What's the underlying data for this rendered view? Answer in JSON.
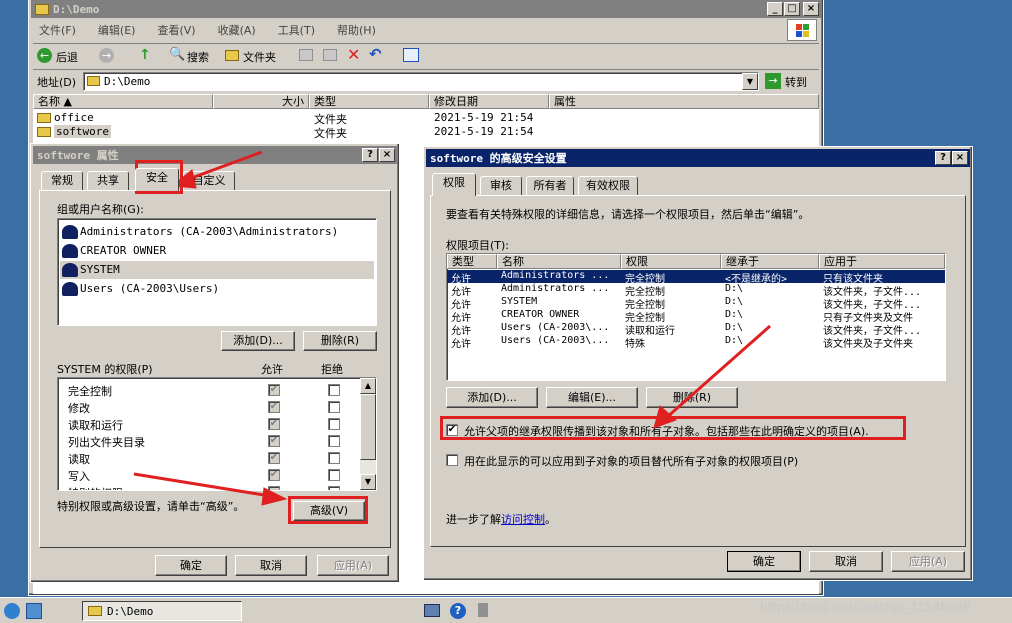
{
  "explorer": {
    "title": "D:\\Demo",
    "menu": [
      "文件(F)",
      "编辑(E)",
      "查看(V)",
      "收藏(A)",
      "工具(T)",
      "帮助(H)"
    ],
    "toolbar": {
      "back": "后退",
      "search": "搜索",
      "folders": "文件夹"
    },
    "address_label": "地址(D)",
    "address_value": "D:\\Demo",
    "go_label": "转到",
    "columns": [
      "名称",
      "大小",
      "类型",
      "修改日期",
      "属性"
    ],
    "files": [
      {
        "name": "office",
        "type": "文件夹",
        "date": "2021-5-19 21:54"
      },
      {
        "name": "softwore",
        "type": "文件夹",
        "date": "2021-5-19 21:54"
      }
    ]
  },
  "props": {
    "title": "softwore 属性",
    "tabs": [
      "常规",
      "共享",
      "安全",
      "自定义"
    ],
    "group_label": "组或用户名称(G):",
    "users": [
      "Administrators (CA-2003\\Administrators)",
      "CREATOR OWNER",
      "SYSTEM",
      "Users (CA-2003\\Users)"
    ],
    "add_button": "添加(D)...",
    "remove_button": "删除(R)",
    "perm_label": "SYSTEM 的权限(P)",
    "allow_label": "允许",
    "deny_label": "拒绝",
    "perms": [
      "完全控制",
      "修改",
      "读取和运行",
      "列出文件夹目录",
      "读取",
      "写入",
      "特别的权限"
    ],
    "advanced_note": "特别权限或高级设置，请单击“高级”。",
    "advanced_button": "高级(V)",
    "ok": "确定",
    "cancel": "取消",
    "apply": "应用(A)"
  },
  "adv": {
    "title": "softwore 的高级安全设置",
    "tabs": [
      "权限",
      "审核",
      "所有者",
      "有效权限"
    ],
    "intro": "要查看有关特殊权限的详细信息，请选择一个权限项目，然后单击“编辑”。",
    "entries_label": "权限项目(T):",
    "columns": [
      "类型",
      "名称",
      "权限",
      "继承于",
      "应用于"
    ],
    "rows": [
      [
        "允许",
        "Administrators ...",
        "完全控制",
        "<不是继承的>",
        "只有该文件夹"
      ],
      [
        "允许",
        "Administrators ...",
        "完全控制",
        "D:\\",
        "该文件夹，子文件..."
      ],
      [
        "允许",
        "SYSTEM",
        "完全控制",
        "D:\\",
        "该文件夹，子文件..."
      ],
      [
        "允许",
        "CREATOR OWNER",
        "完全控制",
        "D:\\",
        "只有子文件夹及文件"
      ],
      [
        "允许",
        "Users (CA-2003\\...",
        "读取和运行",
        "D:\\",
        "该文件夹，子文件..."
      ],
      [
        "允许",
        "Users (CA-2003\\...",
        "特殊",
        "D:\\",
        "该文件夹及子文件夹"
      ]
    ],
    "add_button": "添加(D)...",
    "edit_button": "编辑(E)...",
    "remove_button": "删除(R)",
    "inherit_label": "允许父项的继承权限传播到该对象和所有子对象。包括那些在此明确定义的项目(A).",
    "replace_label": "用在此显示的可以应用到子对象的项目替代所有子对象的权限项目(P)",
    "learn_prefix": "进一步了解",
    "learn_link": "访问控制",
    "learn_suffix": "。",
    "ok": "确定",
    "cancel": "取消",
    "apply": "应用(A)"
  },
  "taskbar": {
    "window": "D:\\Demo"
  },
  "watermark": "https://blog.csdn.net/qq_41548088",
  "colors": {
    "highlight": "#0a246a",
    "accent_red": "#e02020",
    "desktop": "#3a6ea5"
  }
}
